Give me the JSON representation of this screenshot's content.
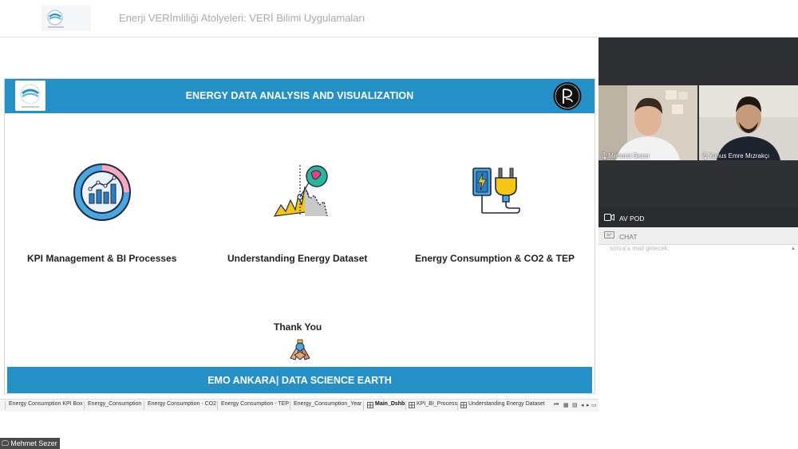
{
  "header": {
    "title": "Enerji VERİmliliği Atolyeleri: VERİ Bilimi Uygulamaları"
  },
  "slide": {
    "title": "ENERGY DATA ANALYSIS AND VISUALIZATION",
    "items": [
      {
        "label": "KPI Management & BI Processes",
        "icon": "kpi-donut-chart-icon"
      },
      {
        "label": "Understanding Energy Dataset",
        "icon": "energy-dataset-chart-icon"
      },
      {
        "label": "Energy Consumption & CO2 & TEP",
        "icon": "battery-plug-icon"
      }
    ],
    "thanks": "Thank You",
    "thanks_icon": "hands-together-icon",
    "footer": "EMO ANKARA| DATA SCIENCE EARTH"
  },
  "tabs": [
    {
      "label": "Energy Consumption KPI Box",
      "active": false
    },
    {
      "label": "Energy_Consumption",
      "active": false
    },
    {
      "label": "Energy Consumption - CO2",
      "active": false
    },
    {
      "label": "Energy Consumption - TEP",
      "active": false
    },
    {
      "label": "Energy_Consumption_Year",
      "active": false
    },
    {
      "label": "Main_Dshb",
      "active": true
    },
    {
      "label": "KPI_BI_Process",
      "active": false
    },
    {
      "label": "Understanding Energy Dataset",
      "active": false
    }
  ],
  "presenter": "Mehmet Sezer",
  "participants": [
    {
      "name": "Mehmet Sezer"
    },
    {
      "name": "Yunus Emre Mızrakçı"
    }
  ],
  "panel": {
    "avpod": "AV POD",
    "chat": "CHAT",
    "chat_preview": "sonra'a mail gelecek."
  },
  "colors": {
    "accent_blue": "#2490c5",
    "video_bg": "#2f3033"
  }
}
